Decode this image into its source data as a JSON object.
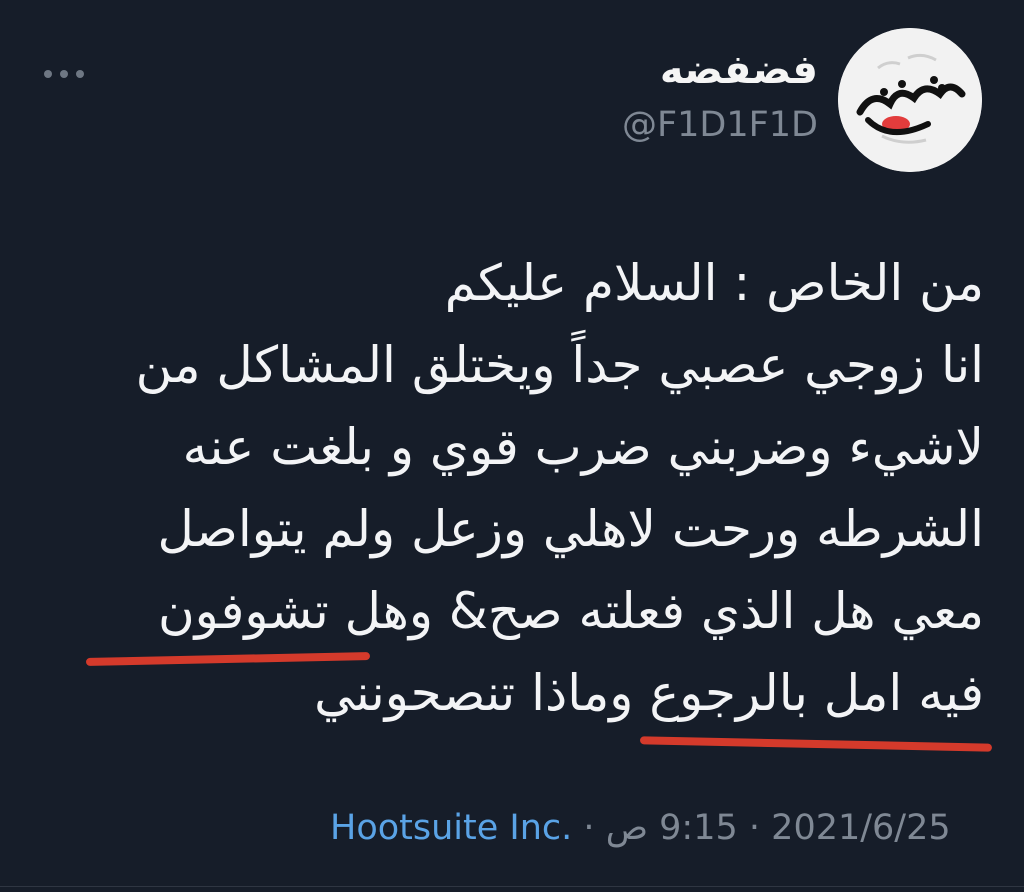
{
  "tweet": {
    "display_name": "فضفضه",
    "handle": "@F1D1F1D",
    "avatar_icon": "fadfada-logo",
    "avatar_text": "فضفضة",
    "more_icon": "more-options-icon",
    "text_lines": [
      "من الخاص : السلام عليكم",
      "انا زوجي عصبي جداً ويختلق المشاكل من",
      "لاشيء وضربني ضرب قوي و بلغت عنه",
      "الشرطه ورحت لاهلي وزعل ولم يتواصل",
      "معي  هل الذي فعلته صح& وهل تشوفون",
      "فيه امل بالرجوع وماذا تنصحونني"
    ],
    "date": "2021/6/25",
    "separator": "·",
    "time": "9:15 ص",
    "source": "Hootsuite Inc.",
    "colors": {
      "background": "#161d29",
      "text": "#f3f4f6",
      "muted": "#7f8894",
      "link": "#5aa3e6",
      "annotation": "#d43a2b"
    }
  }
}
